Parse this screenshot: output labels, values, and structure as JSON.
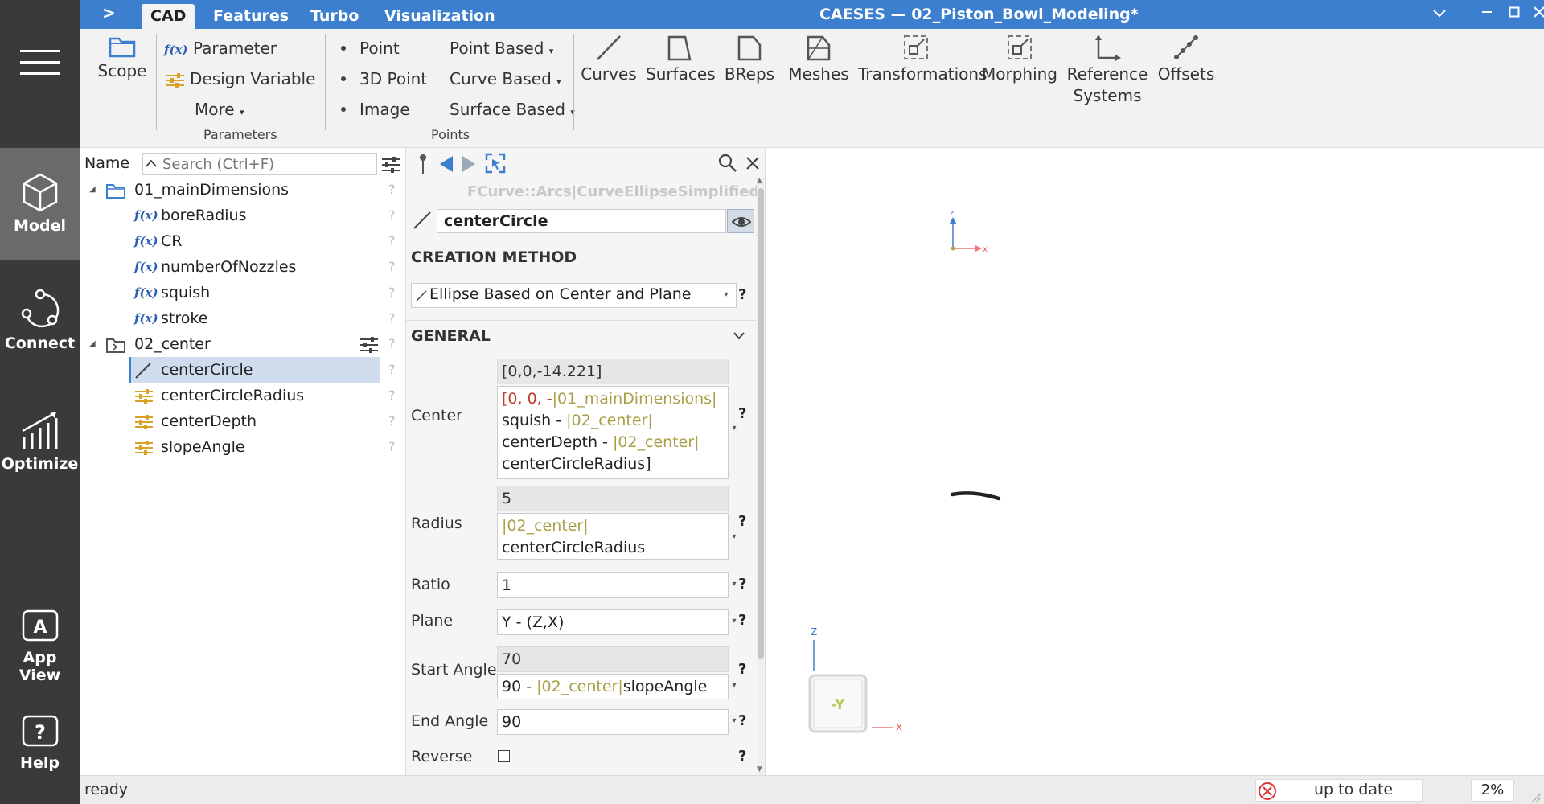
{
  "nav": {
    "items": [
      {
        "label": "Model",
        "icon": "cube-icon"
      },
      {
        "label": "Connect",
        "icon": "connect-icon"
      },
      {
        "label": "Optimize",
        "icon": "optimize-icon"
      },
      {
        "label": "App View",
        "icon": "app-view-icon"
      },
      {
        "label": "Help",
        "icon": "help-icon"
      }
    ]
  },
  "titlebar": {
    "tabs": [
      "CAD",
      "Features",
      "Turbo",
      "Visualization"
    ],
    "title": "CAESES  —  02_Piston_Bowl_Modeling*"
  },
  "ribbon": {
    "scope": "Scope",
    "parameter": "Parameter",
    "design_variable": "Design Variable",
    "more": "More",
    "parameters_group": "Parameters",
    "point": "Point",
    "point3d": "3D Point",
    "image": "Image",
    "point_based": "Point Based",
    "curve_based": "Curve Based",
    "surface_based": "Surface Based",
    "points_group": "Points",
    "big": [
      {
        "label": "Curves",
        "icon": "curve-icon"
      },
      {
        "label": "Surfaces",
        "icon": "surface-icon"
      },
      {
        "label": "BReps",
        "icon": "brep-icon"
      },
      {
        "label": "Meshes",
        "icon": "mesh-icon"
      },
      {
        "label": "Transformations",
        "icon": "transform-icon"
      },
      {
        "label": "Morphing",
        "icon": "morph-icon"
      },
      {
        "label": "Reference Systems",
        "icon": "axis-icon"
      },
      {
        "label": "Offsets",
        "icon": "offset-icon"
      }
    ]
  },
  "tree": {
    "header": "Name",
    "search_placeholder": "Search (Ctrl+F)",
    "rows": [
      {
        "label": "01_mainDimensions",
        "kind": "folder"
      },
      {
        "label": "boreRadius",
        "kind": "param"
      },
      {
        "label": "CR",
        "kind": "param"
      },
      {
        "label": "numberOfNozzles",
        "kind": "param"
      },
      {
        "label": "squish",
        "kind": "param"
      },
      {
        "label": "stroke",
        "kind": "param"
      },
      {
        "label": "02_center",
        "kind": "folder"
      },
      {
        "label": "centerCircle",
        "kind": "curve"
      },
      {
        "label": "centerCircleRadius",
        "kind": "variable"
      },
      {
        "label": "centerDepth",
        "kind": "variable"
      },
      {
        "label": "slopeAngle",
        "kind": "variable"
      }
    ],
    "fx": "f(x)",
    "help": "?"
  },
  "props": {
    "type_path": "FCurve::Arcs|CurveEllipseSimplified",
    "object_name": "centerCircle",
    "creation_method_title": "CREATION METHOD",
    "creation_method": "Ellipse Based on Center and Plane",
    "general_title": "GENERAL",
    "center_label": "Center",
    "center_value": "[0,0,-14.221]",
    "center_expr": {
      "p1": "[0, 0, -",
      "r1": "|01_mainDimensions|",
      "p2": "squish - ",
      "r2": "|02_center|",
      "p3": "centerDepth - ",
      "r3": "|02_center|",
      "p4": "centerCircleRadius]"
    },
    "radius_label": "Radius",
    "radius_value": "5",
    "radius_expr": {
      "r1": "|02_center|",
      "p1": "centerCircleRadius"
    },
    "ratio_label": "Ratio",
    "ratio_value": "1",
    "plane_label": "Plane",
    "plane_value": "Y - (Z,X)",
    "start_angle_label": "Start Angle",
    "start_angle_value": "70",
    "start_angle_expr": {
      "p1": "90 - ",
      "r1": "|02_center|",
      "p2": "slopeAngle"
    },
    "end_angle_label": "End Angle",
    "end_angle_value": "90",
    "reverse_label": "Reverse",
    "help": "?"
  },
  "viewport": {
    "axis_z": "z",
    "axis_x": "x",
    "cube_face": "-Y",
    "axis_z2": "Z",
    "axis_x2": "X"
  },
  "status": {
    "text": "ready",
    "update_state": "up to date",
    "progress": "2%"
  },
  "colors": {
    "titlebar": "#3d7fcf",
    "nav_bg": "#3a3a3a",
    "reference_text": "#a8a046",
    "selection": "#cfdcee"
  }
}
